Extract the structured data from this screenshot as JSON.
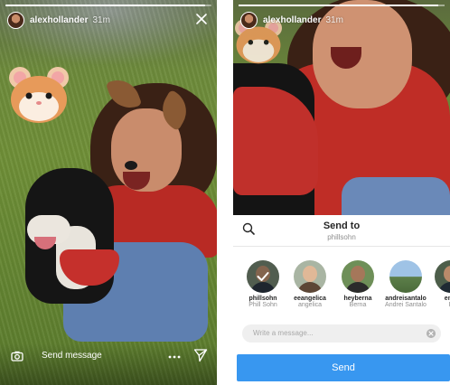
{
  "left_story": {
    "username": "alexhollander",
    "time": "31m",
    "progress": 0.97,
    "footer": {
      "send_message_label": "Send message",
      "icons": [
        "camera-icon",
        "more-icon",
        "direct-send-icon"
      ]
    }
  },
  "right_story": {
    "username": "alexhollander",
    "time": "31m",
    "progress": 0.97
  },
  "share_sheet": {
    "title": "Send to",
    "subtitle": "phillsohn",
    "search_icon": "search-icon",
    "recipients": [
      {
        "username": "phillsohn",
        "name": "Phill Sohn",
        "selected": true
      },
      {
        "username": "eeangelica",
        "name": "angelica",
        "selected": false
      },
      {
        "username": "heyberna",
        "name": "Berna",
        "selected": false
      },
      {
        "username": "andreisantalo",
        "name": "Andrei Santalo",
        "selected": false
      },
      {
        "username": "emn",
        "name": "E",
        "selected": false
      }
    ],
    "message_placeholder": "Write a message...",
    "send_label": "Send"
  },
  "colors": {
    "send_button": "#3897f0",
    "text_primary": "#262626",
    "text_secondary": "#8e8e8e"
  }
}
